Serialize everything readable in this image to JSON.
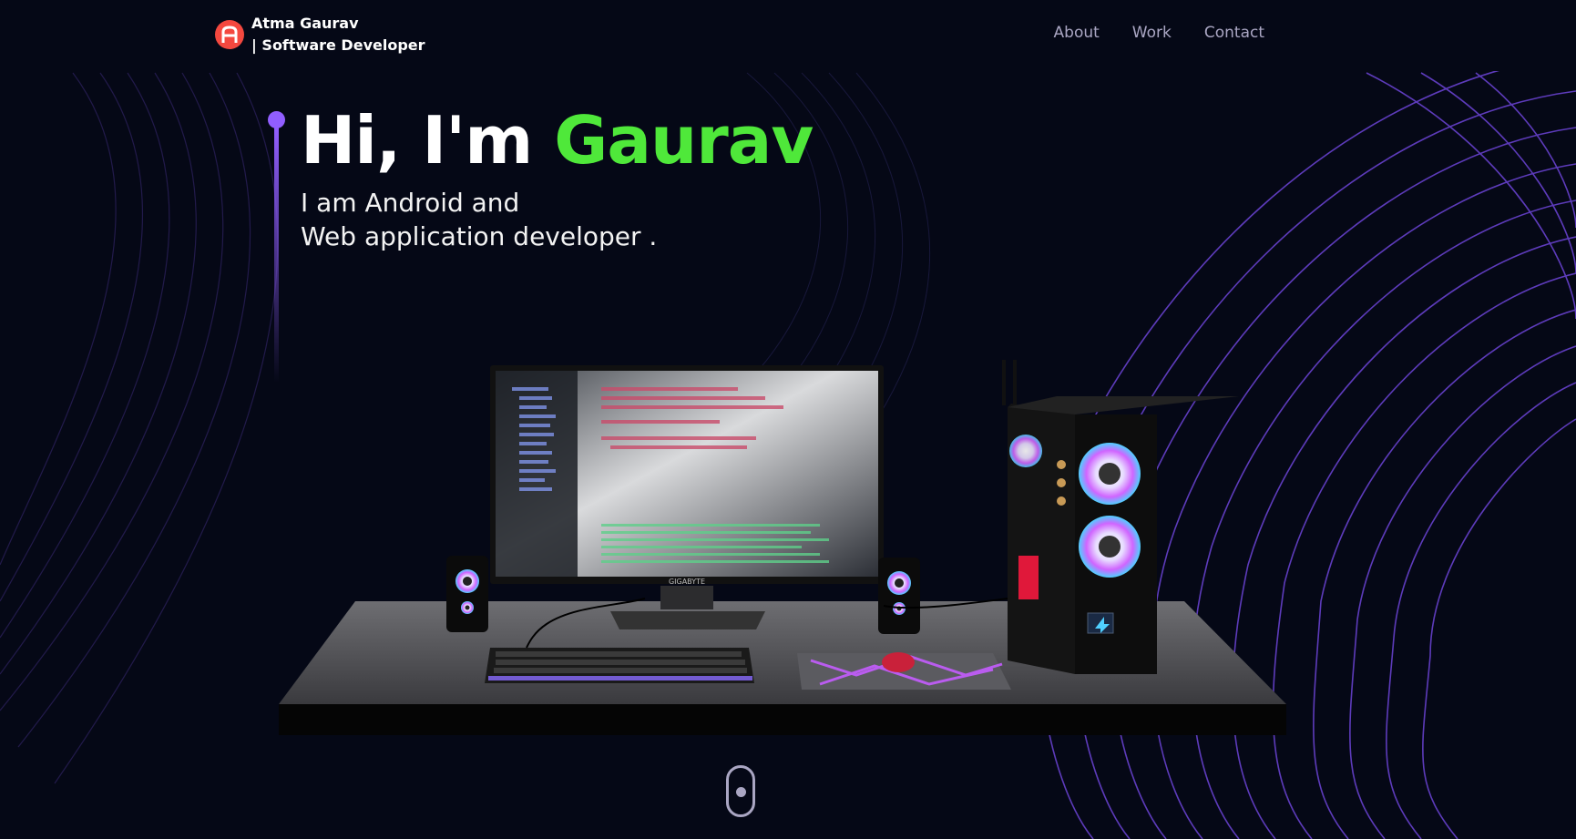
{
  "navbar": {
    "brand_name": "Atma Gaurav",
    "brand_role": "| Software Developer",
    "links": [
      "About",
      "Work",
      "Contact"
    ]
  },
  "hero": {
    "greeting": "Hi, I'm ",
    "name": "Gaurav",
    "subtitle_line1": "I am Android and",
    "subtitle_line2": "Web application developer ."
  },
  "scene": {
    "monitor_brand": "GIGABYTE"
  },
  "colors": {
    "background": "#050816",
    "accent_purple": "#915eff",
    "name_green": "#4fe83a",
    "logo_red": "#f4483f",
    "nav_text": "#aaa6c3"
  },
  "icons": {
    "logo": "letter-a-logo-icon",
    "scroll": "mouse-scroll-icon"
  }
}
